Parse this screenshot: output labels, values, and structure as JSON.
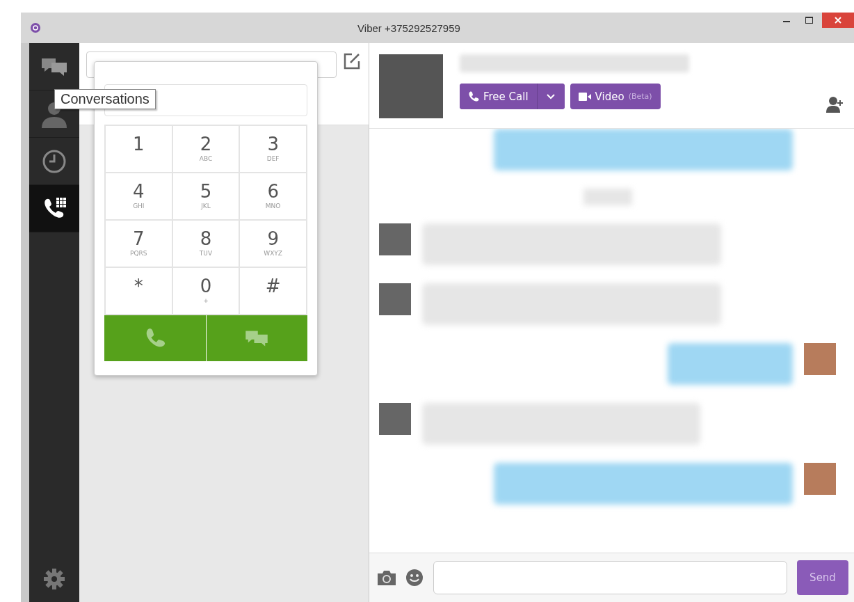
{
  "window": {
    "title": "Viber +375292527959"
  },
  "sidebar": {
    "items": [
      {
        "kind": "conversations",
        "selected": false
      },
      {
        "kind": "contacts",
        "selected": false
      },
      {
        "kind": "recent",
        "selected": false
      },
      {
        "kind": "dialpad",
        "selected": true
      }
    ]
  },
  "tooltip": "Conversations",
  "dialpad": {
    "keys": [
      {
        "digit": "1"
      },
      {
        "digit": "2",
        "letters": "ABC"
      },
      {
        "digit": "3",
        "letters": "DEF"
      },
      {
        "digit": "4",
        "letters": "GHI"
      },
      {
        "digit": "5",
        "letters": "JKL"
      },
      {
        "digit": "6",
        "letters": "MNO"
      },
      {
        "digit": "7",
        "letters": "PQRS"
      },
      {
        "digit": "8",
        "letters": "TUV"
      },
      {
        "digit": "9",
        "letters": "WXYZ"
      },
      {
        "digit": "*"
      },
      {
        "digit": "0",
        "letters": "+"
      },
      {
        "digit": "#"
      }
    ]
  },
  "chat_header": {
    "call_button": "Free Call",
    "video_button": "Video",
    "video_note": "(Beta)"
  },
  "messages": [
    {
      "kind": "continued"
    },
    {
      "kind": "date"
    },
    {
      "kind": "incoming"
    },
    {
      "kind": "incoming"
    },
    {
      "kind": "outgoing"
    },
    {
      "kind": "incoming"
    },
    {
      "kind": "outgoing"
    }
  ],
  "composer": {
    "send_button": "Send"
  }
}
